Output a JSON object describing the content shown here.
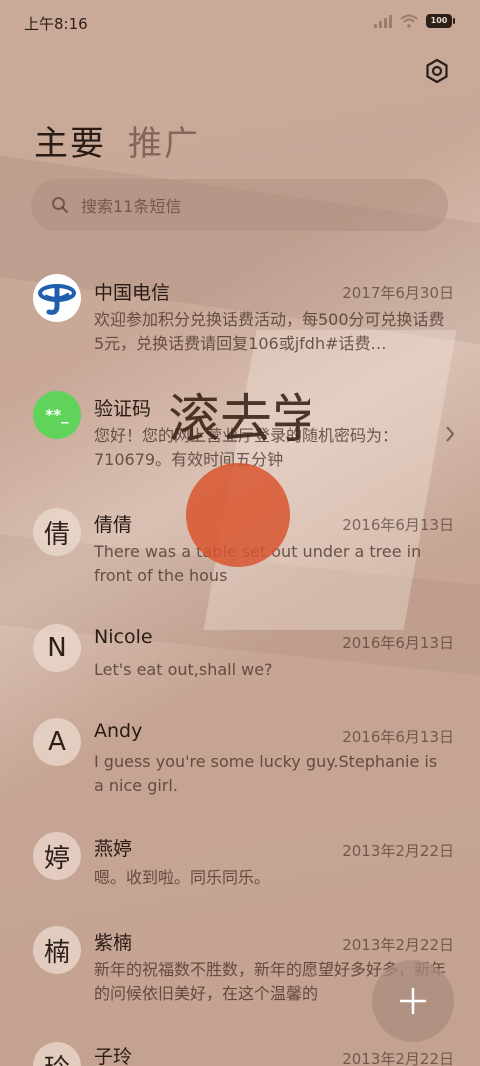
{
  "status_bar": {
    "time": "上午8:16",
    "battery": "100"
  },
  "tabs": [
    {
      "label": "主要"
    },
    {
      "label": "推广"
    }
  ],
  "search": {
    "placeholder": "搜索11条短信"
  },
  "conversations": [
    {
      "avatar": "logo",
      "name": "中国电信",
      "date": "2017年6月30日",
      "preview": "欢迎参加积分兑换话费活动，每500分可兑换话费5元，兑换话费请回复106或jfdh#话费…"
    },
    {
      "avatar": "**_",
      "name": "验证码",
      "date": "",
      "preview": "您好！您的网上营业厅登录的随机密码为：710679。有效时间五分钟"
    },
    {
      "avatar": "倩",
      "name": "倩倩",
      "date": "2016年6月13日",
      "preview": "There was a table set out under a tree in front of the hous"
    },
    {
      "avatar": "N",
      "name": "Nicole",
      "date": "2016年6月13日",
      "preview": "Let's eat out,shall we?"
    },
    {
      "avatar": "A",
      "name": "Andy",
      "date": "2016年6月13日",
      "preview": "I guess you're some lucky guy.Stephanie is a nice girl."
    },
    {
      "avatar": "婷",
      "name": "燕婷",
      "date": "2013年2月22日",
      "preview": "嗯。收到啦。同乐同乐。"
    },
    {
      "avatar": "楠",
      "name": "紫楠",
      "date": "2013年2月22日",
      "preview": "新年的祝福数不胜数，新年的愿望好多好多，新年的问候依旧美好，在这个温馨的"
    },
    {
      "avatar": "玲",
      "name": "子玲",
      "date": "2013年2月22日",
      "preview": ""
    }
  ],
  "watermark_text": "滚去学习",
  "colors": {
    "background": "#c8a797",
    "verify_avatar": "#5fd35a",
    "telecom_blue": "#1f5fae",
    "seal_red": "#d8552f"
  },
  "icons": {
    "settings": "settings-icon",
    "search": "search-icon",
    "compose": "plus-icon",
    "chevron": "chevron-right-icon"
  }
}
